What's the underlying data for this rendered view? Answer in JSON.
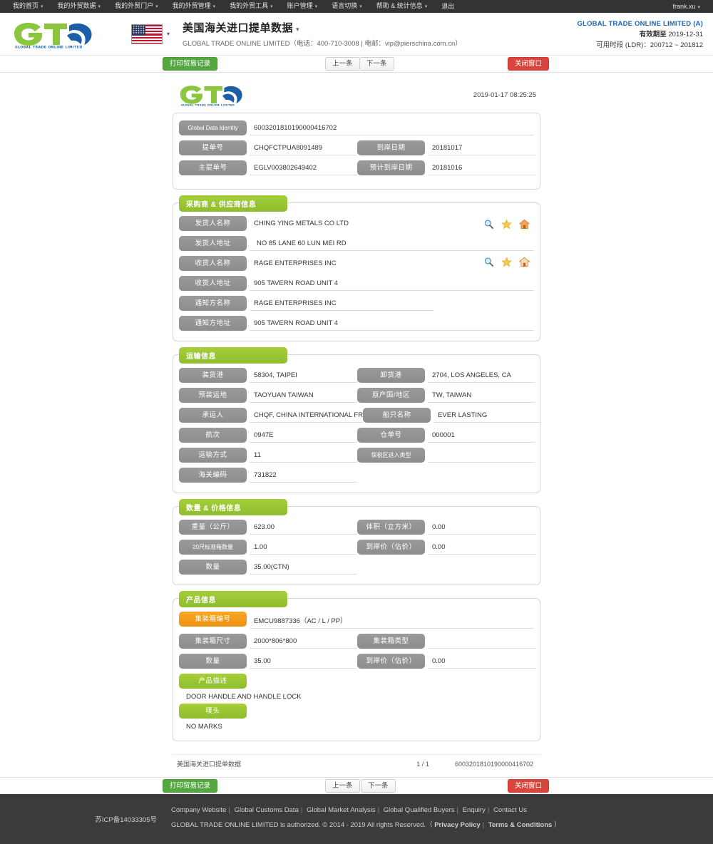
{
  "topnav": {
    "items": [
      {
        "label": "我的首页",
        "caret": true
      },
      {
        "label": "我的外贸数据",
        "caret": true
      },
      {
        "label": "我的外贸门户",
        "caret": true
      },
      {
        "label": "我的外贸管理",
        "caret": true
      },
      {
        "label": "我的外贸工具",
        "caret": true
      },
      {
        "label": "账户管理",
        "caret": true
      },
      {
        "label": "语言切换",
        "caret": true
      },
      {
        "label": "帮助 & 统计信息",
        "caret": true
      },
      {
        "label": "退出",
        "caret": false
      }
    ],
    "user": "frank.xu",
    "user_caret": "▾"
  },
  "header": {
    "logo_text": "GLOBAL TRADE ONLINE LIMITED",
    "flag_name": "us-flag-icon",
    "title": "美国海关进口提单数据",
    "title_caret": "▾",
    "subtitle": "GLOBAL TRADE ONLINE LIMITED（电话：400-710-3008 | 电邮：vip@pierschina.com.cn）",
    "account_company": "GLOBAL TRADE ONLINE LIMITED (A)",
    "account_valid_label": "有效期至",
    "account_valid_value": "2019-12-31",
    "account_ldr": "可用时段 (LDR)：200712 ~ 201812"
  },
  "toolbar": {
    "print_label": "打印贸易记录",
    "prev_label": "上一条",
    "next_label": "下一条",
    "close_label": "关闭窗口"
  },
  "document": {
    "timestamp": "2019-01-17 08:25:25",
    "identity": {
      "gdi_label": "Global Data Identity",
      "gdi_value": "6003201810190000416702",
      "rows": [
        {
          "label": "提单号",
          "value": "CHQFCTPUA8091489",
          "label2": "到岸日期",
          "value2": "20181017"
        },
        {
          "label": "主提单号",
          "value": "EGLV003802649402",
          "label2": "预计到岸日期",
          "value2": "20181016"
        }
      ]
    },
    "parties": {
      "title": "采购商 & 供应商信息",
      "rows": [
        {
          "label": "发货人名称",
          "value": "CHING YING METALS CO LTD",
          "icons": true
        },
        {
          "label": "发货人地址",
          "value": "NO 85 LANE 60 LUN MEI RD",
          "icons": false
        },
        {
          "label": "收货人名称",
          "value": "RAGE ENTERPRISES INC",
          "icons": true
        },
        {
          "label": "收货人地址",
          "value": "905 TAVERN ROAD UNIT 4",
          "icons": false
        },
        {
          "label": "通知方名称",
          "value": "RAGE ENTERPRISES INC",
          "icons": false
        },
        {
          "label": "通知方地址",
          "value": "905 TAVERN ROAD UNIT 4",
          "icons": false
        }
      ],
      "icon_names": [
        "search-icon",
        "star-icon",
        "home-icon"
      ]
    },
    "transport": {
      "title": "运输信息",
      "rows": [
        {
          "label": "装货港",
          "value": "58304, TAIPEI",
          "label2": "卸货港",
          "value2": "2704, LOS ANGELES, CA"
        },
        {
          "label": "预装运地",
          "value": "TAOYUAN TAIWAN",
          "label2": "原产国/地区",
          "value2": "TW, TAIWAN"
        },
        {
          "label": "承运人",
          "value": "CHQF, CHINA INTERNATIONAL FR",
          "label2": "船只名称",
          "value2": "EVER LASTING"
        },
        {
          "label": "航次",
          "value": "0947E",
          "label2": "仓单号",
          "value2": "000001"
        },
        {
          "label": "运输方式",
          "value": "11",
          "label2": "保税区进入类型",
          "value2": ""
        },
        {
          "label": "海关编码",
          "value": "731822",
          "label2": "",
          "value2": ""
        }
      ]
    },
    "quantity": {
      "title": "数量 & 价格信息",
      "rows": [
        {
          "label": "重量（公斤）",
          "value": "623.00",
          "label2": "体积（立方米）",
          "value2": "0.00"
        },
        {
          "label": "20尺标准箱数量",
          "value": "1.00",
          "label2": "到岸价（估价）",
          "value2": "0.00"
        },
        {
          "label": "数量",
          "value": "35.00(CTN)",
          "label2": "",
          "value2": ""
        }
      ]
    },
    "product": {
      "title": "产品信息",
      "container_no_label": "集装箱编号",
      "container_no_value": "EMCU9887336（AC / L / PP）",
      "rows": [
        {
          "label": "集装箱尺寸",
          "value": "2000*806*800",
          "label2": "集装箱类型",
          "value2": ""
        },
        {
          "label": "数量",
          "value": "35.00",
          "label2": "到岸价（估价）",
          "value2": "0.00"
        }
      ],
      "desc_label": "产品描述",
      "desc_value": "DOOR HANDLE AND HANDLE LOCK",
      "marks_label": "唛头",
      "marks_value": "NO MARKS"
    },
    "footer": {
      "left": "美国海关进口提单数据",
      "page": "1 / 1",
      "right": "6003201810190000416702"
    }
  },
  "pagefooter": {
    "icp": "苏ICP备14033305号",
    "links": [
      "Company Website",
      "Global Customs Data",
      "Global Market Analysis",
      "Global Qualified Buyers",
      "Enquiry",
      "Contact Us"
    ],
    "copy_prefix": "GLOBAL TRADE ONLINE LIMITED is authorized. © 2014 - 2019 All rights Reserved.（",
    "copy_link1": "Privacy Policy",
    "copy_link2": "Terms & Conditions",
    "copy_suffix": "）"
  },
  "colors": {
    "brand_green": "#8fbd2f",
    "brand_blue": "#2166b5",
    "danger_red": "#d9453c",
    "pill_gray": "#8d8d8d",
    "pill_orange": "#ef9311",
    "nav_dark": "#333333",
    "footer_dark": "#3b3b3b"
  }
}
